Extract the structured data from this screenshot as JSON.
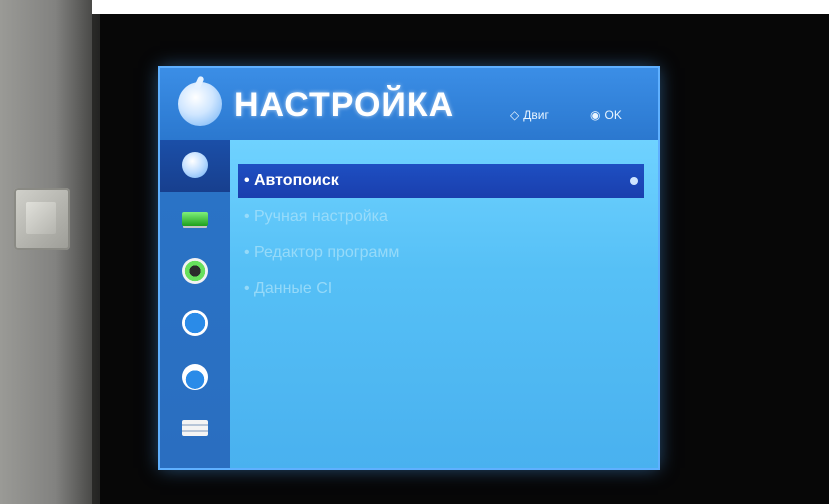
{
  "menu": {
    "title": "НАСТРОЙКА",
    "hints": {
      "move_symbol": "◇",
      "move_label": "Двиг",
      "ok_symbol": "◉",
      "ok_label": "OK"
    },
    "sidebar": [
      {
        "icon": "satellite-dish-icon",
        "active": true
      },
      {
        "icon": "picture-icon",
        "active": false
      },
      {
        "icon": "audio-icon",
        "active": false
      },
      {
        "icon": "time-icon",
        "active": false
      },
      {
        "icon": "lock-icon",
        "active": false
      },
      {
        "icon": "options-icon",
        "active": false
      }
    ],
    "items": [
      {
        "bullet": "•",
        "label": "Автопоиск",
        "selected": true
      },
      {
        "bullet": "•",
        "label": "Ручная настройка",
        "selected": false
      },
      {
        "bullet": "•",
        "label": "Редактор программ",
        "selected": false
      },
      {
        "bullet": "•",
        "label": "Данные CI",
        "selected": false
      }
    ]
  },
  "colors": {
    "screen_blue": "#2c7fd4",
    "selection_blue": "#1e4fc2",
    "content_cyan": "#56c0f6"
  }
}
